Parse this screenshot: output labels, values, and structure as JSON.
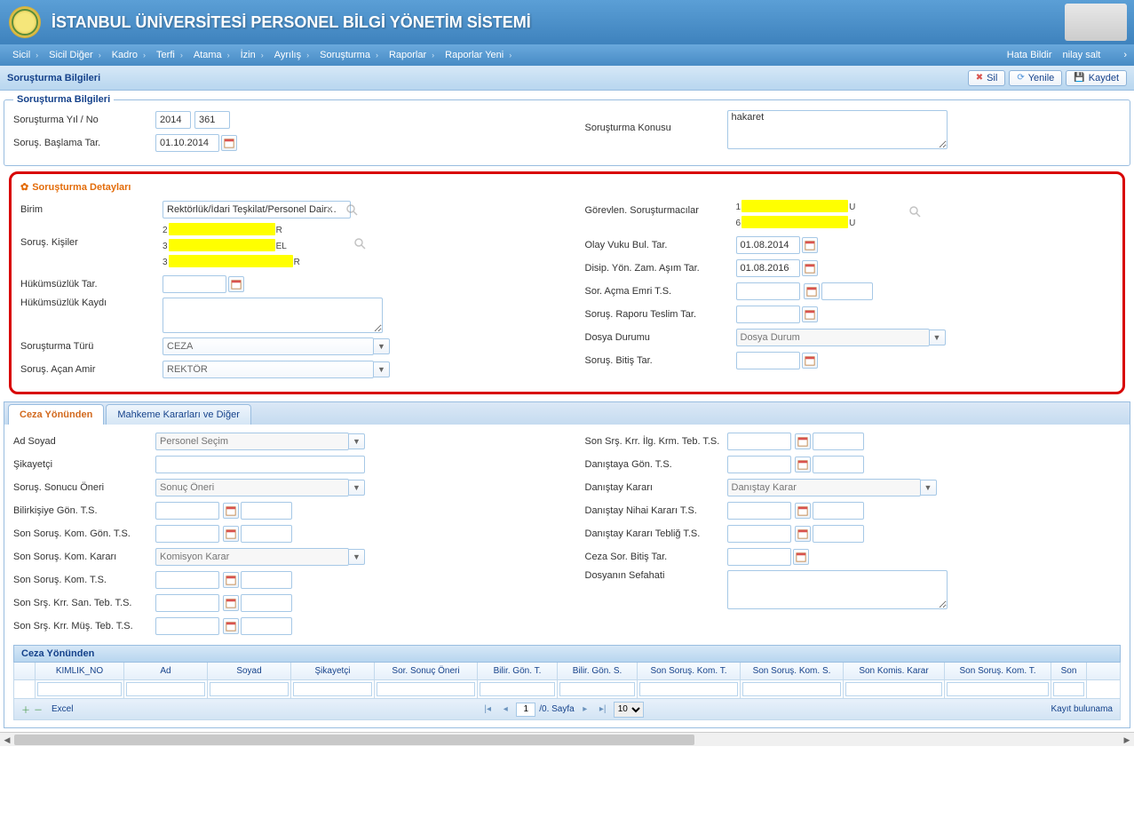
{
  "header": {
    "title": "İSTANBUL ÜNİVERSİTESİ PERSONEL BİLGİ YÖNETİM SİSTEMİ"
  },
  "menu": {
    "left": [
      "Sicil",
      "Sicil Diğer",
      "Kadro",
      "Terfi",
      "Atama",
      "İzin",
      "Ayrılış",
      "Soruşturma",
      "Raporlar",
      "Raporlar Yeni"
    ],
    "right": [
      "Hata Bildir",
      "nilay salt"
    ]
  },
  "toolbar": {
    "title": "Soruşturma Bilgileri",
    "buttons": {
      "sil": "Sil",
      "yenile": "Yenile",
      "kaydet": "Kaydet"
    }
  },
  "section1": {
    "legend": "Soruşturma Bilgileri",
    "labels": {
      "yilno": "Soruşturma Yıl / No",
      "baslama": "Soruş. Başlama Tar.",
      "konu": "Soruşturma Konusu"
    },
    "values": {
      "yil": "2014",
      "no": "361",
      "baslama": "01.10.2014",
      "konu": "hakaret"
    }
  },
  "details": {
    "title": "Soruşturma Detayları",
    "labels": {
      "birim": "Birim",
      "kisiler": "Soruş. Kişiler",
      "hukumsuzluk_tar": "Hükümsüzlük Tar.",
      "hukumsuzluk_kaydi": "Hükümsüzlük Kaydı",
      "turu": "Soruşturma Türü",
      "amir": "Soruş. Açan Amir",
      "sorusturmacilar": "Görevlen. Soruşturmacılar",
      "olay": "Olay Vuku Bul. Tar.",
      "disip": "Disip. Yön. Zam. Aşım Tar.",
      "sor_acma": "Sor. Açma Emri T.S.",
      "rapor_teslim": "Soruş. Raporu Teslim Tar.",
      "dosya_durumu": "Dosya Durumu",
      "bitis": "Soruş. Bitiş Tar."
    },
    "values": {
      "birim": "Rektörlük/İdari Teşkilat/Personel Dair…",
      "olay": "01.08.2014",
      "disip": "01.08.2016",
      "turu": "CEZA",
      "amir": "REKTÖR",
      "dosya_durumu_ph": "Dosya Durum"
    },
    "kisiler": [
      {
        "pre": "2",
        "suf": "R"
      },
      {
        "pre": "3",
        "suf": "EL"
      },
      {
        "pre": "3",
        "suf": "R"
      }
    ],
    "sorusturmacilar": [
      {
        "pre": "1",
        "suf": "U"
      },
      {
        "pre": "6",
        "suf": "U"
      }
    ]
  },
  "tabs": {
    "t1": "Ceza Yönünden",
    "t2": "Mahkeme Kararları ve Diğer"
  },
  "ceza": {
    "labels": {
      "adsoyad": "Ad Soyad",
      "adsoyad_ph": "Personel Seçim",
      "sikayetci": "Şikayetçi",
      "sonuc_oneri": "Soruş. Sonucu Öneri",
      "sonuc_oneri_ph": "Sonuç Öneri",
      "bilirkisiye": "Bilirkişiye Gön. T.S.",
      "son_sorus_gon": "Son Soruş. Kom. Gön. T.S.",
      "son_sorus_kom_karari": "Son Soruş. Kom. Kararı",
      "komisyon_ph": "Komisyon Karar",
      "son_sorus_kom_ts": "Son Soruş. Kom. T.S.",
      "son_srs_san": "Son Srş. Krr. San. Teb. T.S.",
      "son_srs_mus": "Son Srş. Krr. Müş. Teb. T.S.",
      "son_srs_ilg": "Son Srş. Krr. İlg. Krm. Teb. T.S.",
      "danistay_gon": "Danıştaya Gön. T.S.",
      "danistay_karari": "Danıştay Kararı",
      "danistay_ph": "Danıştay Karar",
      "danistay_nihai": "Danıştay Nihai Kararı T.S.",
      "danistay_teblig": "Danıştay Kararı Tebliğ T.S.",
      "ceza_bitis": "Ceza Sor. Bitiş Tar.",
      "dosya_sefahati": "Dosyanın Sefahati"
    }
  },
  "grid": {
    "title": "Ceza Yönünden",
    "cols": [
      "",
      "KIMLIK_NO",
      "Ad",
      "Soyad",
      "Şikayetçi",
      "Sor. Sonuç Öneri",
      "Bilir. Gön. T.",
      "Bilir. Gön. S.",
      "Son Soruş. Kom. T.",
      "Son Soruş. Kom. S.",
      "Son Komis. Karar",
      "Son Soruş. Kom. T.",
      "Son"
    ],
    "footer": {
      "excel": "Excel",
      "page_val": "1",
      "page_text": "/0. Sayfa",
      "page_size": "10",
      "status": "Kayıt bulunama"
    }
  }
}
